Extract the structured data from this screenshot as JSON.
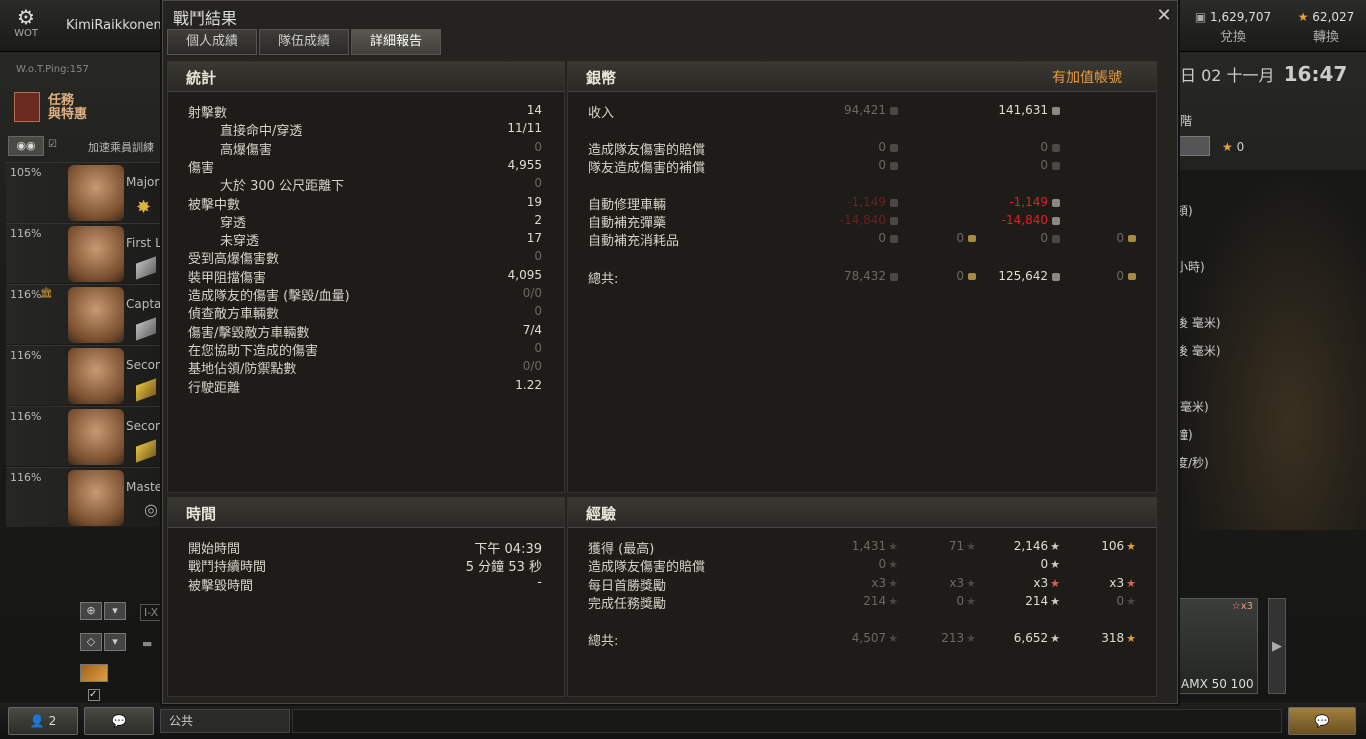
{
  "app": {
    "logo_label": "WOT",
    "player": "KimiRaikkonen"
  },
  "currency": {
    "credits": "1,629,707",
    "credits_action": "兌換",
    "xp": "62,027",
    "xp_action": "轉換"
  },
  "ping": "W.o.T.Ping:157",
  "mission": {
    "line1": "任務",
    "line2": "與特惠"
  },
  "crew_header": {
    "label": "加速乘員訓練"
  },
  "crew": [
    {
      "pct": "105%",
      "rank": "Major"
    },
    {
      "pct": "116%",
      "rank": "First L"
    },
    {
      "pct": "116%",
      "rank": "Captai"
    },
    {
      "pct": "116%",
      "rank": "Secon"
    },
    {
      "pct": "116%",
      "rank": "Secon"
    },
    {
      "pct": "116%",
      "rank": "Maste"
    }
  ],
  "left_controls": {
    "filter_label": "I-X"
  },
  "bottom": {
    "friends_count": "2",
    "chat_channel": "公共"
  },
  "right_bg": {
    "date": "日 02 十一月",
    "time": "16:47",
    "labels": [
      "階",
      "0",
      "頓)",
      "小時)",
      "後 毫米)",
      "後 毫米)",
      "毫米)",
      "鐘)",
      "度/秒)"
    ],
    "tank_name": "AMX 50 100",
    "tank_badge": "x3"
  },
  "dialog": {
    "title": "戰鬥結果",
    "tabs": [
      "個人成績",
      "隊伍成績",
      "詳細報告"
    ],
    "active_tab": 2,
    "stats": {
      "title": "統計",
      "rows": [
        {
          "label": "射擊數",
          "value": "14",
          "indent": false,
          "dim": false
        },
        {
          "label": "直接命中/穿透",
          "value": "11/11",
          "indent": true,
          "dim": false
        },
        {
          "label": "高爆傷害",
          "value": "0",
          "indent": true,
          "dim": true
        },
        {
          "label": "傷害",
          "value": "4,955",
          "indent": false,
          "dim": false
        },
        {
          "label": "大於 300 公尺距離下",
          "value": "0",
          "indent": true,
          "dim": true
        },
        {
          "label": "被擊中數",
          "value": "19",
          "indent": false,
          "dim": false
        },
        {
          "label": "穿透",
          "value": "2",
          "indent": true,
          "dim": false
        },
        {
          "label": "未穿透",
          "value": "17",
          "indent": true,
          "dim": false
        },
        {
          "label": "受到高爆傷害數",
          "value": "0",
          "indent": false,
          "dim": true
        },
        {
          "label": "裝甲阻擋傷害",
          "value": "4,095",
          "indent": false,
          "dim": false
        },
        {
          "label": "造成隊友的傷害 (擊毀/血量)",
          "value": "0/0",
          "indent": false,
          "dim": true
        },
        {
          "label": "偵查敵方車輛數",
          "value": "0",
          "indent": false,
          "dim": true
        },
        {
          "label": "傷害/擊毀敵方車輛數",
          "value": "7/4",
          "indent": false,
          "dim": false
        },
        {
          "label": "在您協助下造成的傷害",
          "value": "0",
          "indent": false,
          "dim": true
        },
        {
          "label": "基地佔領/防禦點數",
          "value": "0/0",
          "indent": false,
          "dim": true
        },
        {
          "label": "行駛距離",
          "value": "1.22",
          "indent": false,
          "dim": false
        }
      ]
    },
    "credits": {
      "title": "銀幣",
      "premium_label": "有加值帳號",
      "rows": [
        {
          "label": "收入",
          "a": "94,421",
          "b": "",
          "c": "141,631",
          "d": ""
        },
        {
          "label": "造成隊友傷害的賠償",
          "a": "0",
          "b": "",
          "c": "0",
          "d": ""
        },
        {
          "label": "隊友造成傷害的補償",
          "a": "0",
          "b": "",
          "c": "0",
          "d": ""
        },
        {
          "label": "自動修理車輛",
          "a": "-1,149",
          "b": "",
          "c": "-1,149",
          "d": ""
        },
        {
          "label": "自動補充彈藥",
          "a": "-14,840",
          "b": "",
          "c": "-14,840",
          "d": ""
        },
        {
          "label": "自動補充消耗品",
          "a": "0",
          "b": "0",
          "c": "0",
          "d": "0"
        },
        {
          "label": "總共:",
          "a": "78,432",
          "b": "0",
          "c": "125,642",
          "d": "0"
        }
      ]
    },
    "time": {
      "title": "時間",
      "rows": [
        {
          "label": "開始時間",
          "value": "下午 04:39"
        },
        {
          "label": "戰鬥持續時間",
          "value": "5 分鐘 53 秒"
        },
        {
          "label": "被擊毀時間",
          "value": "-"
        }
      ]
    },
    "xp": {
      "title": "經驗",
      "rows": [
        {
          "label": "獲得 (最高)",
          "a": "1,431",
          "b": "71",
          "c": "2,146",
          "d": "106"
        },
        {
          "label": "造成隊友傷害的賠償",
          "a": "0",
          "b": "",
          "c": "0",
          "d": ""
        },
        {
          "label": "每日首勝獎勵",
          "a": "x3",
          "b": "x3",
          "c": "x3",
          "d": "x3"
        },
        {
          "label": "完成任務獎勵",
          "a": "214",
          "b": "0",
          "c": "214",
          "d": "0"
        },
        {
          "label": "總共:",
          "a": "4,507",
          "b": "213",
          "c": "6,652",
          "d": "318"
        }
      ]
    }
  },
  "colors": {
    "accent_orange": "#e89a40",
    "penalty_red": "#e02020",
    "dim_text": "#6a6860"
  }
}
